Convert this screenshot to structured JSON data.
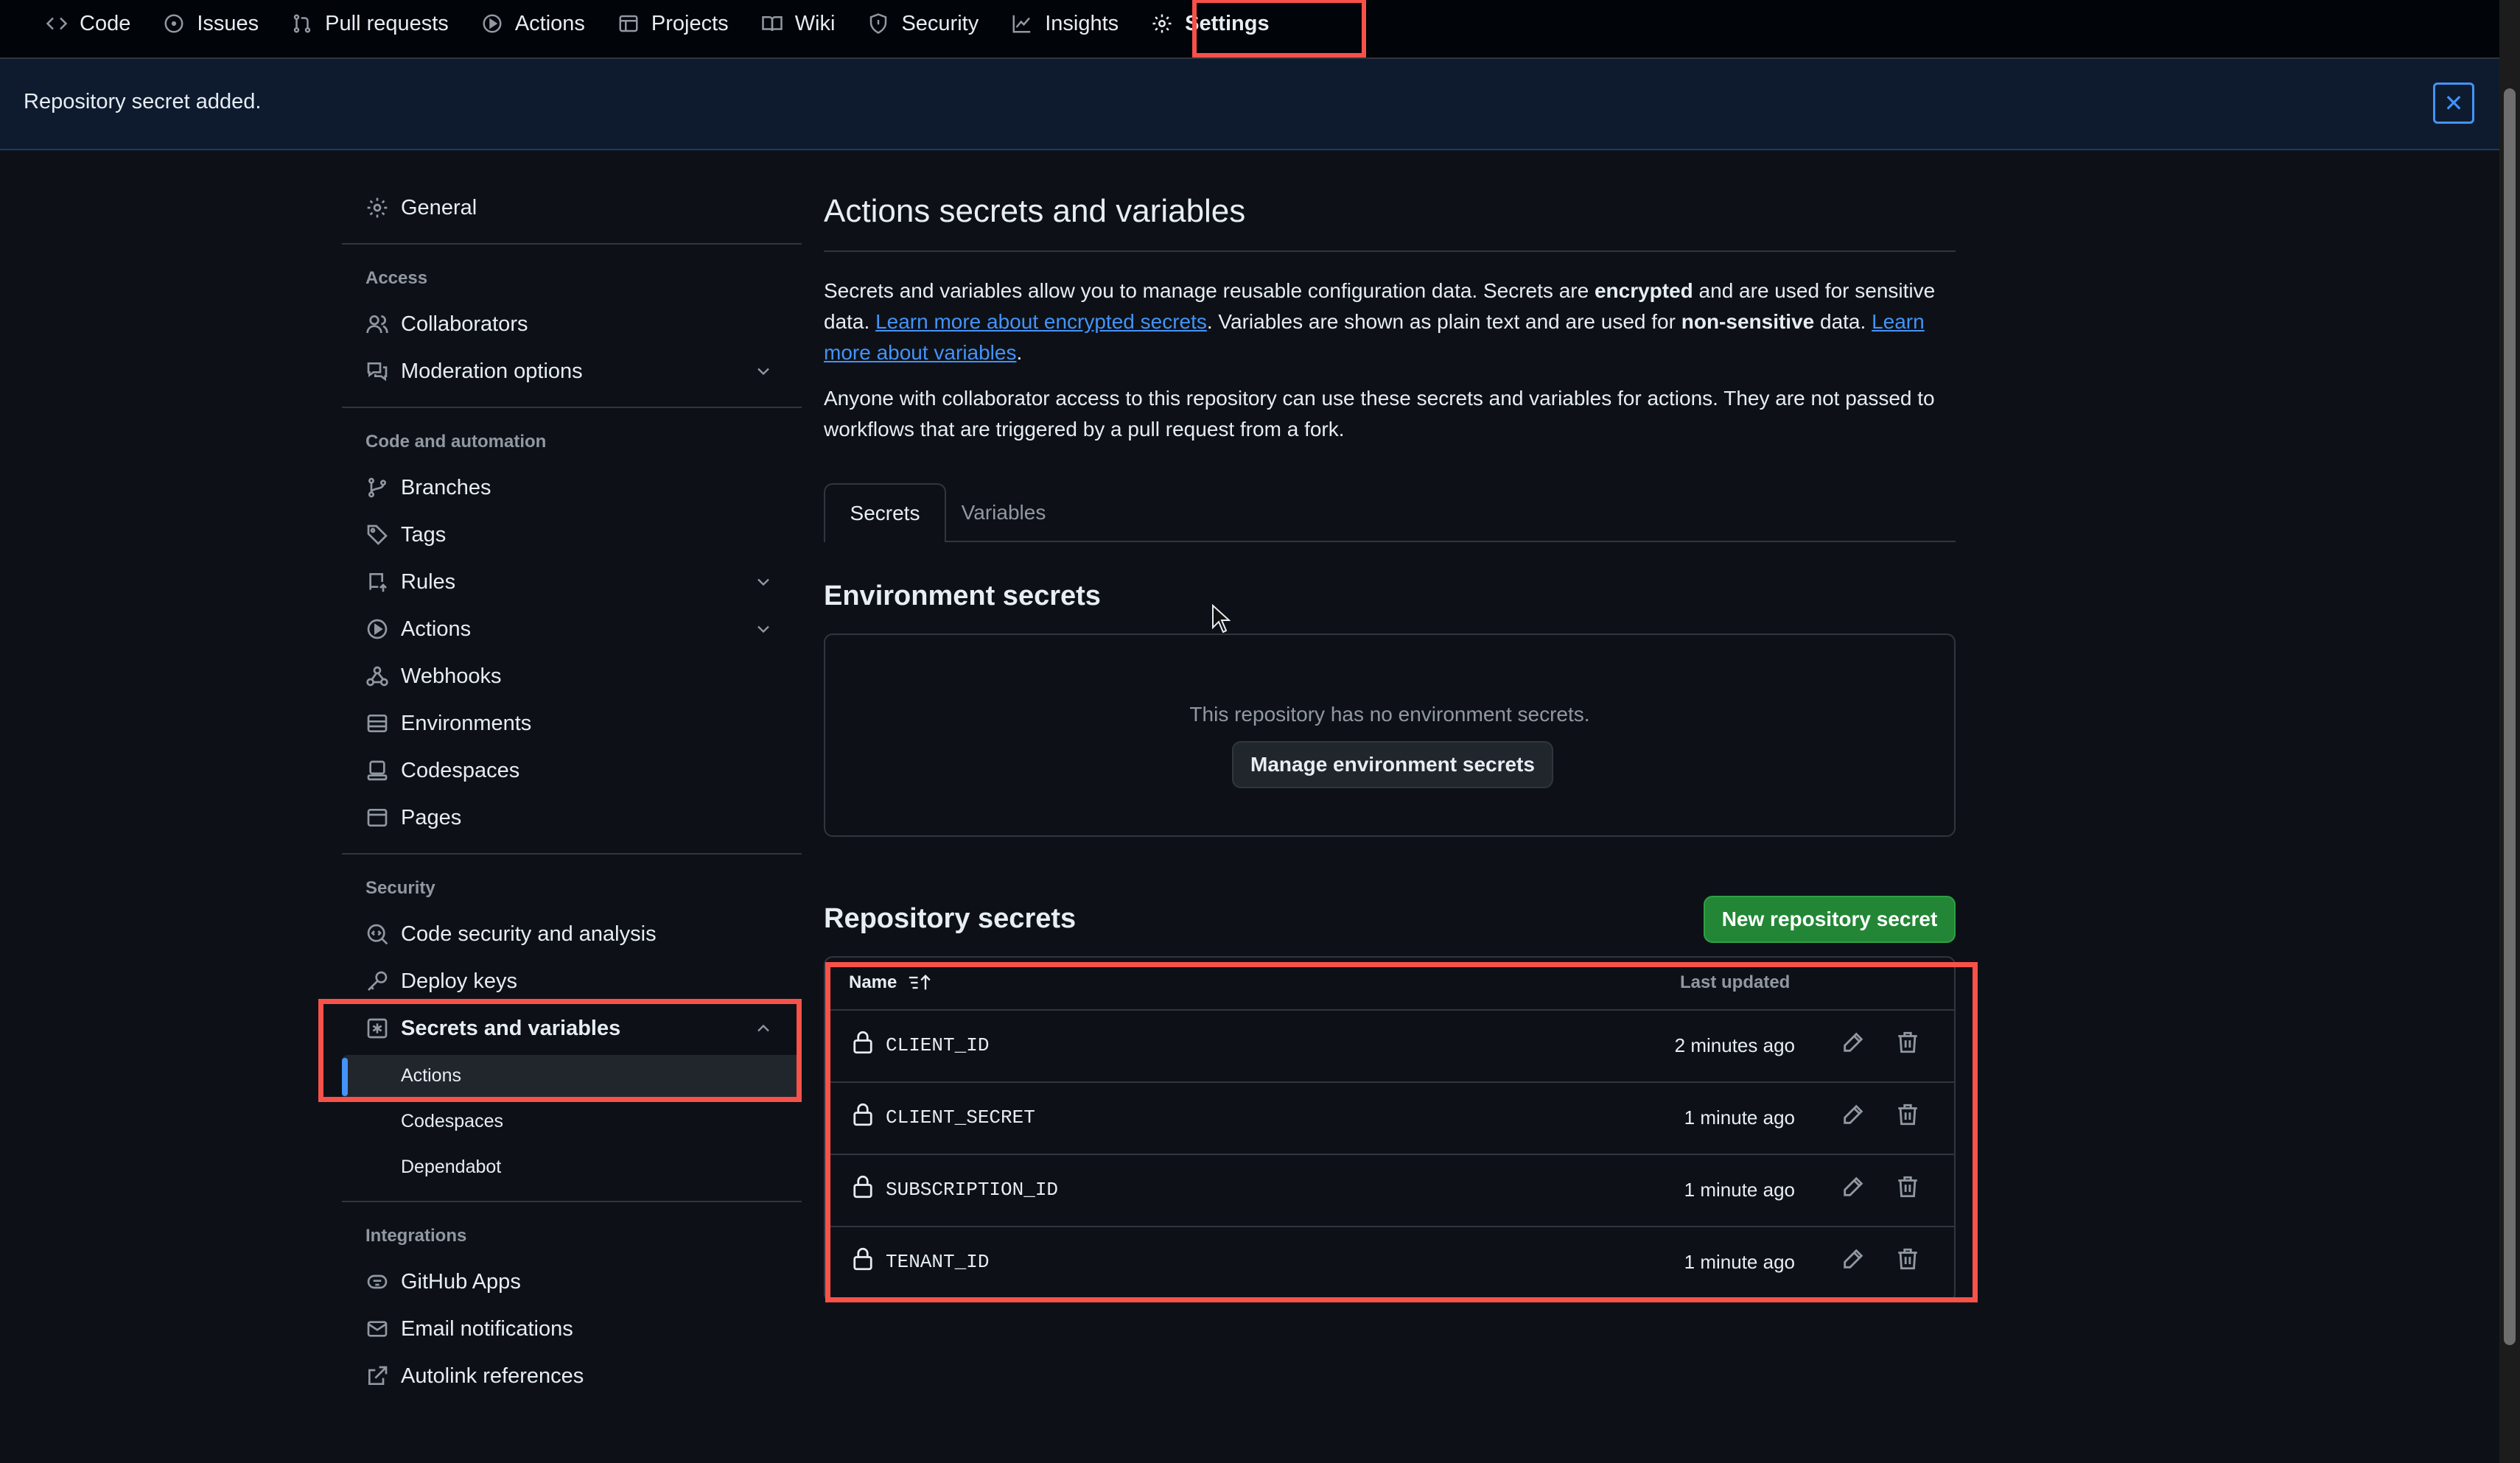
{
  "topnav": {
    "items": [
      {
        "label": "Code",
        "icon": "code-icon"
      },
      {
        "label": "Issues",
        "icon": "issue-opened-icon"
      },
      {
        "label": "Pull requests",
        "icon": "git-pull-request-icon"
      },
      {
        "label": "Actions",
        "icon": "play-icon"
      },
      {
        "label": "Projects",
        "icon": "table-icon"
      },
      {
        "label": "Wiki",
        "icon": "book-icon"
      },
      {
        "label": "Security",
        "icon": "shield-icon"
      },
      {
        "label": "Insights",
        "icon": "graph-icon"
      },
      {
        "label": "Settings",
        "icon": "gear-icon"
      }
    ],
    "active": "Settings"
  },
  "flash": {
    "message": "Repository secret added."
  },
  "sidebar": {
    "general": "General",
    "access_heading": "Access",
    "collaborators": "Collaborators",
    "moderation": "Moderation options",
    "code_heading": "Code and automation",
    "branches": "Branches",
    "tags": "Tags",
    "rules": "Rules",
    "actions": "Actions",
    "webhooks": "Webhooks",
    "environments": "Environments",
    "codespaces": "Codespaces",
    "pages": "Pages",
    "security_heading": "Security",
    "code_security": "Code security and analysis",
    "deploy_keys": "Deploy keys",
    "secrets_variables": "Secrets and variables",
    "sub_actions": "Actions",
    "sub_codespaces": "Codespaces",
    "sub_dependabot": "Dependabot",
    "integrations_heading": "Integrations",
    "github_apps": "GitHub Apps",
    "email_notifications": "Email notifications",
    "autolink": "Autolink references"
  },
  "main": {
    "title": "Actions secrets and variables",
    "intro": {
      "p1": "Secrets and variables allow you to manage reusable configuration data. Secrets are ",
      "p1_bold1": "encrypted",
      "p1_b": " and are used for sensitive data. ",
      "link_secrets": "Learn more about encrypted secrets",
      "p1_c": ". Variables are shown as plain text and are used for ",
      "p1_bold2": "non-sensitive",
      "p1_d": " data. ",
      "link_variables": "Learn more about variables",
      "p1_e": ".",
      "p2": "Anyone with collaborator access to this repository can use these secrets and variables for actions. They are not passed to workflows that are triggered by a pull request from a fork."
    },
    "tabs": [
      {
        "label": "Secrets",
        "active": true
      },
      {
        "label": "Variables",
        "active": false
      }
    ],
    "env_title": "Environment secrets",
    "env_empty": "This repository has no environment secrets.",
    "env_button": "Manage environment secrets",
    "repo_title": "Repository secrets",
    "new_button": "New repository secret",
    "table": {
      "col_name": "Name",
      "col_updated": "Last updated",
      "rows": [
        {
          "name": "CLIENT_ID",
          "updated": "2 minutes ago"
        },
        {
          "name": "CLIENT_SECRET",
          "updated": "1 minute ago"
        },
        {
          "name": "SUBSCRIPTION_ID",
          "updated": "1 minute ago"
        },
        {
          "name": "TENANT_ID",
          "updated": "1 minute ago"
        }
      ]
    }
  },
  "colors": {
    "background": "#0d1117",
    "accent_link": "#4493f8",
    "primary_button": "#238636",
    "highlight": "#f85149"
  }
}
